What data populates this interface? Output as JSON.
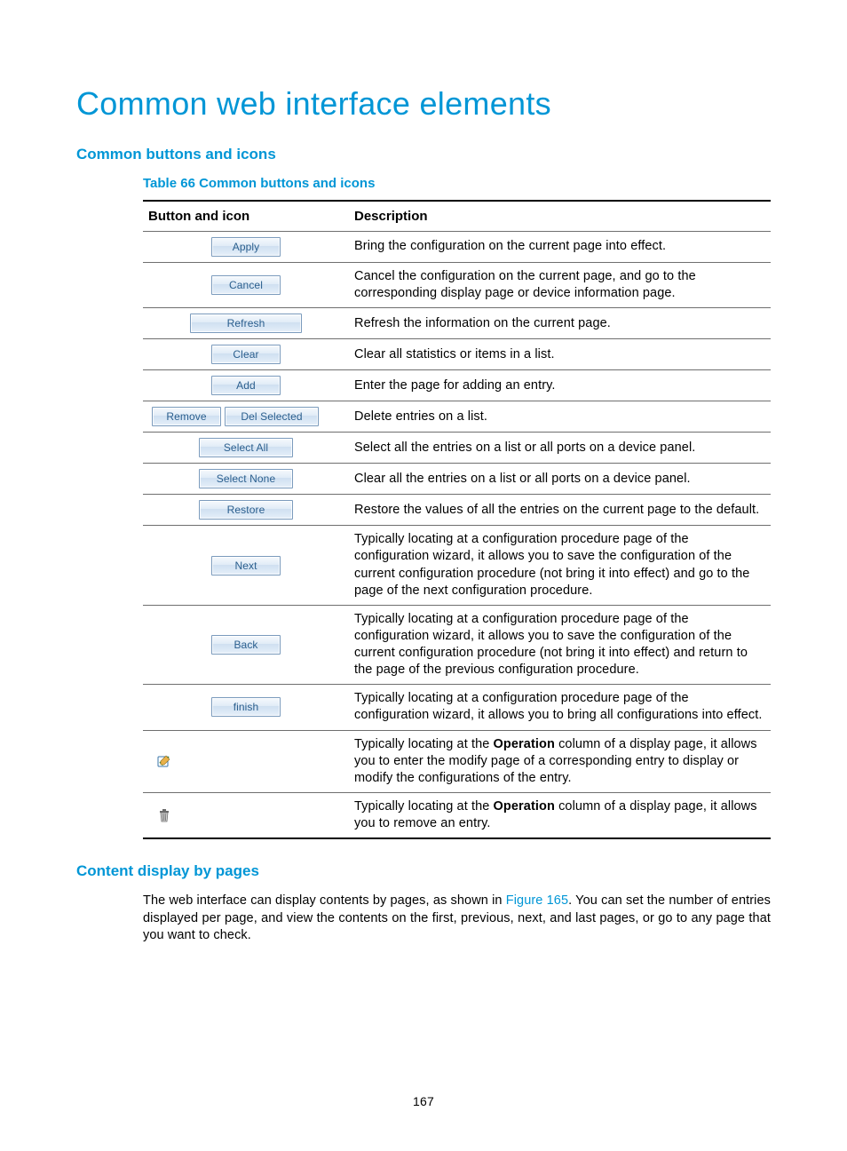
{
  "page_number": "167",
  "title": "Common web interface elements",
  "section1_title": "Common buttons and icons",
  "table_caption": "Table 66 Common buttons and icons",
  "headers": {
    "col1": "Button and icon",
    "col2": "Description"
  },
  "buttons": {
    "apply": "Apply",
    "cancel": "Cancel",
    "refresh": "Refresh",
    "clear": "Clear",
    "add": "Add",
    "remove": "Remove",
    "del_selected": "Del Selected",
    "select_all": "Select All",
    "select_none": "Select None",
    "restore": "Restore",
    "next": "Next",
    "back": "Back",
    "finish": "finish"
  },
  "desc": {
    "apply": "Bring the configuration on the current page into effect.",
    "cancel": "Cancel the configuration on the current page, and go to the corresponding display page or device information page.",
    "refresh": "Refresh the information on the current page.",
    "clear": "Clear all statistics or items in a list.",
    "add": "Enter the page for adding an entry.",
    "remove": "Delete entries on a list.",
    "select_all": "Select all the entries on a list or all ports on a device panel.",
    "select_none": "Clear all the entries on a list or all ports on a device panel.",
    "restore": "Restore the values of all the entries on the current page to the default.",
    "next": "Typically locating at a configuration procedure page of the configuration wizard, it allows you to save the configuration of the current configuration procedure (not bring it into effect) and go to the page of the next configuration procedure.",
    "back": "Typically locating at a configuration procedure page of the configuration wizard, it allows you to save the configuration of the current configuration procedure (not bring it into effect) and return to the page of the previous configuration procedure.",
    "finish": "Typically locating at a configuration procedure page of the configuration wizard, it allows you to bring all configurations into effect.",
    "modify_pre": "Typically locating at the ",
    "modify_bold": "Operation",
    "modify_post": " column of a display page, it allows you to enter the modify page of a corresponding entry to display or modify the configurations of the entry.",
    "trash_pre": "Typically locating at the ",
    "trash_bold": "Operation",
    "trash_post": " column of a display page, it allows you to remove an entry."
  },
  "section2_title": "Content display by pages",
  "para": {
    "pre": "The web interface can display contents by pages, as shown in ",
    "link": "Figure 165",
    "post": ". You can set the number of entries displayed per page, and view the contents on the first, previous, next, and last pages, or go to any page that you want to check."
  }
}
